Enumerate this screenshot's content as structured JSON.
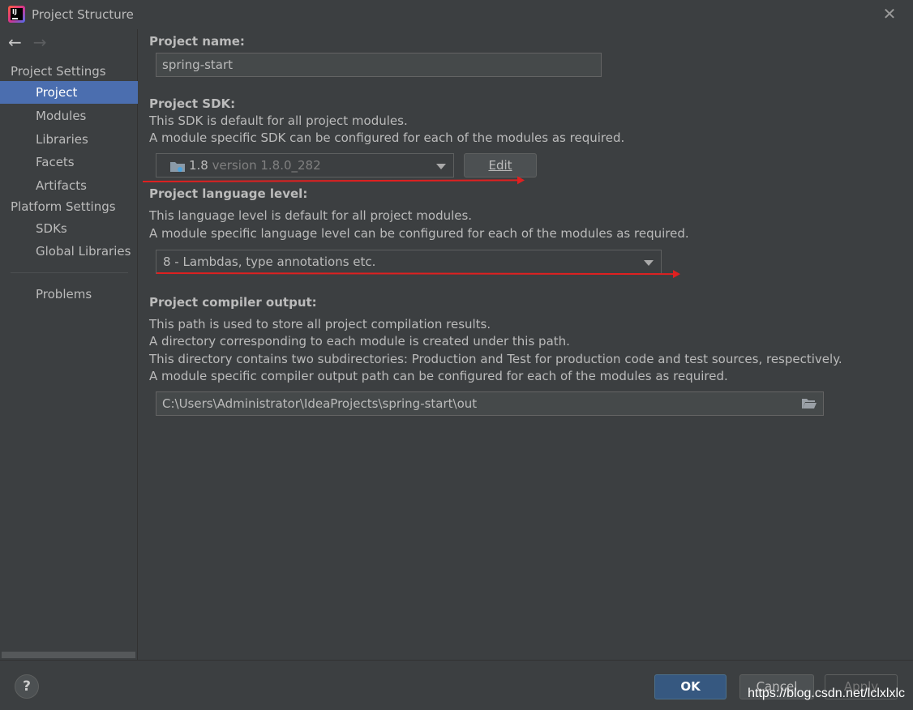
{
  "window": {
    "title": "Project Structure"
  },
  "sidebar": {
    "project_settings_header": "Project Settings",
    "project_settings_items": [
      {
        "label": "Project",
        "selected": true
      },
      {
        "label": "Modules",
        "selected": false
      },
      {
        "label": "Libraries",
        "selected": false
      },
      {
        "label": "Facets",
        "selected": false
      },
      {
        "label": "Artifacts",
        "selected": false
      }
    ],
    "platform_settings_header": "Platform Settings",
    "platform_settings_items": [
      {
        "label": "SDKs"
      },
      {
        "label": "Global Libraries"
      }
    ],
    "problems_label": "Problems"
  },
  "main": {
    "project_name": {
      "label": "Project name:",
      "value": "spring-start"
    },
    "project_sdk": {
      "label": "Project SDK:",
      "desc1": "This SDK is default for all project modules.",
      "desc2": "A module specific SDK can be configured for each of the modules as required.",
      "selected_name": "1.8",
      "selected_version": "version 1.8.0_282",
      "edit_label": "Edit"
    },
    "language_level": {
      "label": "Project language level:",
      "desc1": "This language level is default for all project modules.",
      "desc2": "A module specific language level can be configured for each of the modules as required.",
      "selected": "8 - Lambdas, type annotations etc."
    },
    "compiler_output": {
      "label": "Project compiler output:",
      "desc1": "This path is used to store all project compilation results.",
      "desc2": "A directory corresponding to each module is created under this path.",
      "desc3": "This directory contains two subdirectories: Production and Test for production code and test sources, respectively.",
      "desc4": "A module specific compiler output path can be configured for each of the modules as required.",
      "path": "C:\\Users\\Administrator\\IdeaProjects\\spring-start\\out"
    }
  },
  "footer": {
    "help_label": "?",
    "ok_label": "OK",
    "cancel_label": "Cancel",
    "apply_label": "Apply",
    "watermark": "https://blog.csdn.net/lclxlxlc"
  },
  "colors": {
    "background": "#3c3f41",
    "selection": "#4b6eaf",
    "primary_button": "#365880",
    "annotation": "#e02020"
  }
}
